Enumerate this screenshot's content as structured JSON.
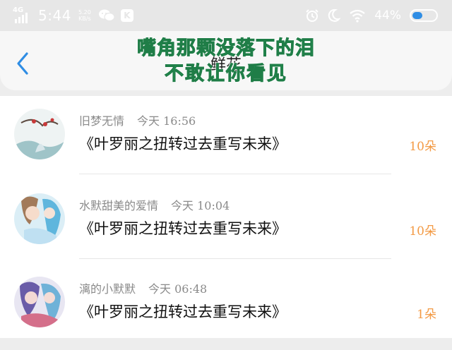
{
  "status_bar": {
    "network": "4G",
    "time": "5:44",
    "speed_value": "5.20",
    "speed_unit": "KB/s",
    "app_badge": "K",
    "battery_percent": "44%",
    "battery_level": 0.44,
    "battery_color": "#2f8de4"
  },
  "header": {
    "title": "鲜花",
    "overlay_line1": "嘴角那颗没落下的泪",
    "overlay_line2": "不敢让你看见",
    "back_icon": "chevron-left-icon",
    "accent_color": "#2f8de4"
  },
  "messages": [
    {
      "name": "旧梦无情",
      "time": "今天 16:56",
      "text": "《叶罗丽之扭转过去重写未来》",
      "count": "10朵"
    },
    {
      "name": "水默甜美的爱情",
      "time": "今天 10:04",
      "text": "《叶罗丽之扭转过去重写未来》",
      "count": "10朵"
    },
    {
      "name": "漓的小默默",
      "time": "今天 06:48",
      "text": "《叶罗丽之扭转过去重写未来》",
      "count": "1朵"
    }
  ],
  "colors": {
    "count": "#f39a44",
    "overlay": "#2fb86b"
  }
}
